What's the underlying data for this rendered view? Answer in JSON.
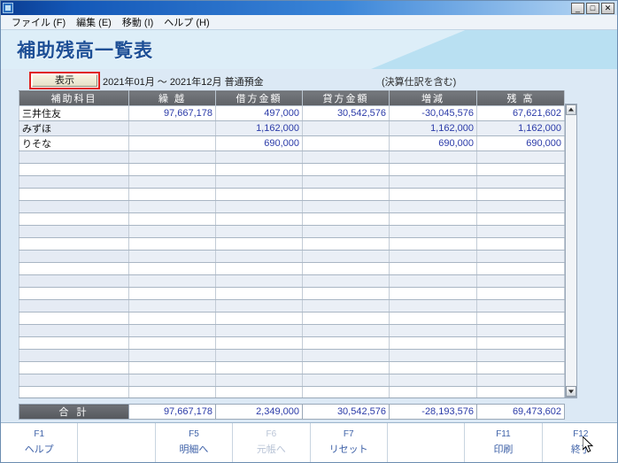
{
  "window": {
    "title": "",
    "controls": {
      "minimize": "_",
      "maximize": "□",
      "close": "✕"
    }
  },
  "menubar": {
    "items": [
      {
        "label": "ファイル (F)"
      },
      {
        "label": "編集 (E)"
      },
      {
        "label": "移動 (I)"
      },
      {
        "label": "ヘルプ (H)"
      }
    ]
  },
  "banner": {
    "title": "補助残高一覧表"
  },
  "toolbar": {
    "display_button": "表示",
    "range_text": "2021年01月 ～ 2021年12月  普通預金",
    "note_text": "(決算仕訳を含む)"
  },
  "table": {
    "headers": [
      "補助科目",
      "繰  越",
      "借方金額",
      "貸方金額",
      "増減",
      "残  高"
    ],
    "rows": [
      {
        "name": "三井住友",
        "carryover": "97,667,178",
        "debit": "497,000",
        "credit": "30,542,576",
        "change": "-30,045,576",
        "balance": "67,621,602"
      },
      {
        "name": "みずほ",
        "carryover": "",
        "debit": "1,162,000",
        "credit": "",
        "change": "1,162,000",
        "balance": "1,162,000"
      },
      {
        "name": "りそな",
        "carryover": "",
        "debit": "690,000",
        "credit": "",
        "change": "690,000",
        "balance": "690,000"
      }
    ],
    "empty_row_count": 21,
    "total": {
      "label": "合  計",
      "carryover": "97,667,178",
      "debit": "2,349,000",
      "credit": "30,542,576",
      "change": "-28,193,576",
      "balance": "69,473,602"
    }
  },
  "function_keys": [
    {
      "key": "F1",
      "label": "ヘルプ",
      "disabled": false
    },
    {
      "key": "",
      "label": "",
      "disabled": true
    },
    {
      "key": "F5",
      "label": "明細へ",
      "disabled": false
    },
    {
      "key": "F6",
      "label": "元帳へ",
      "disabled": true
    },
    {
      "key": "F7",
      "label": "リセット",
      "disabled": false
    },
    {
      "key": "",
      "label": "",
      "disabled": true
    },
    {
      "key": "F11",
      "label": "印刷",
      "disabled": false
    },
    {
      "key": "F12",
      "label": "終了",
      "disabled": false
    }
  ],
  "colors": {
    "banner_bg": "#ddeef8",
    "banner_accent": "#b9e0f2",
    "title_text": "#1d4f96",
    "page_bg": "#dce9f5",
    "header_row": "#5e6166",
    "number_text": "#2b3ba8",
    "highlight_border": "#e02020",
    "fkey_text": "#3f62a8"
  }
}
